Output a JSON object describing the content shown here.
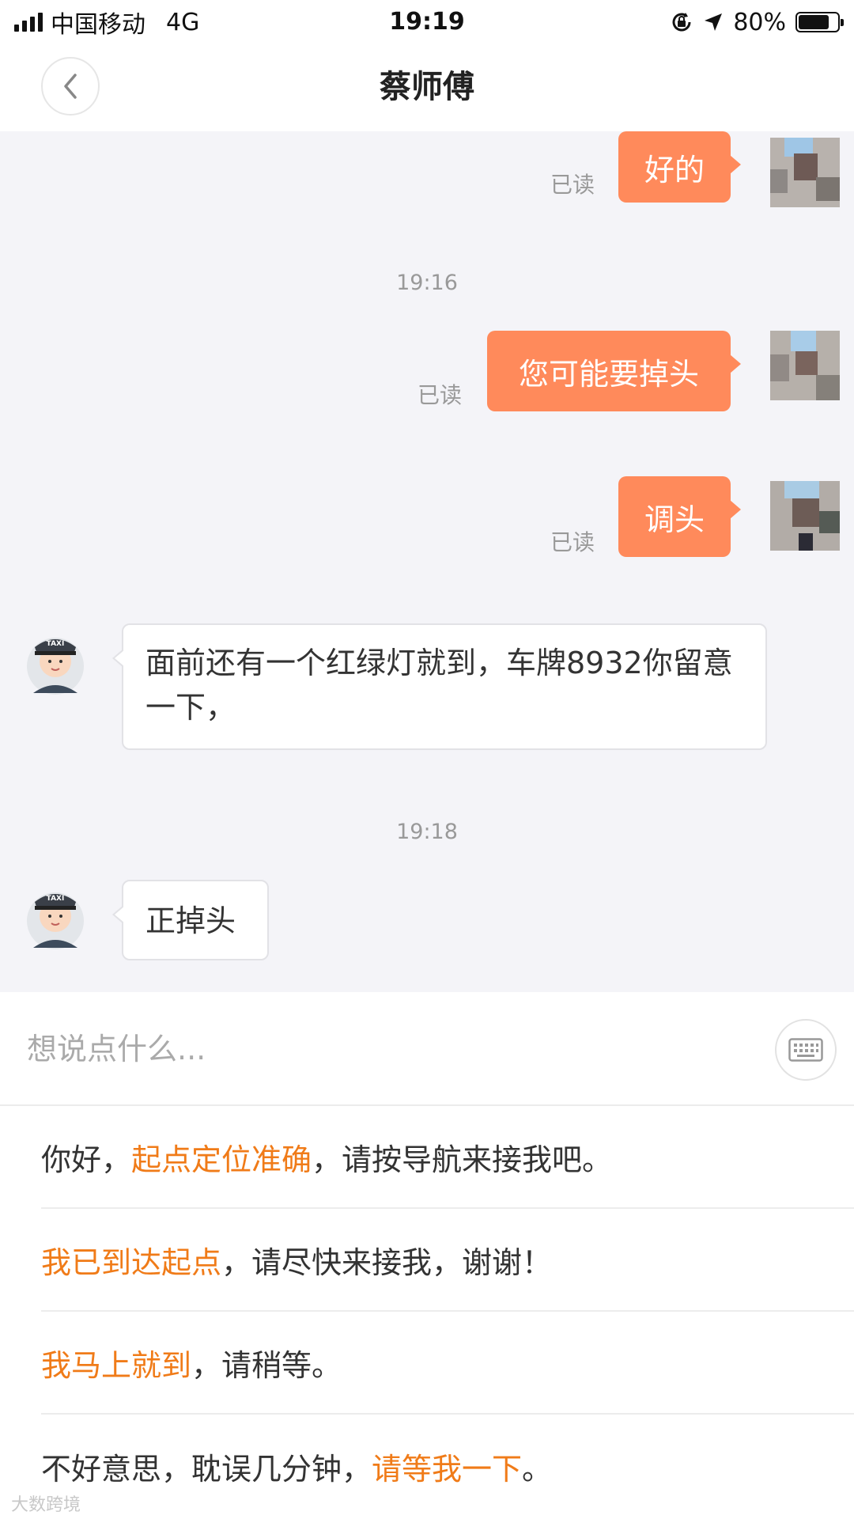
{
  "status_bar": {
    "carrier": "中国移动",
    "network": "4G",
    "time": "19:19",
    "battery": "80%",
    "battery_level": 0.8,
    "icons": [
      "signal-icon",
      "rotation-lock-icon",
      "location-arrow-icon",
      "battery-icon"
    ]
  },
  "header": {
    "title": "蔡师傅",
    "back_icon": "chevron-left-icon"
  },
  "chat": {
    "accent_color": "#ff8a5b",
    "messages": [
      {
        "from": "me",
        "text": "好的",
        "status": "已读"
      },
      {
        "timestamp": "19:16"
      },
      {
        "from": "me",
        "text": "您可能要掉头",
        "status": "已读"
      },
      {
        "from": "me",
        "text": "调头",
        "status": "已读"
      },
      {
        "from": "driver",
        "text": "面前还有一个红绿灯就到，车牌8932你留意一下，",
        "avatar_badge": "TAXI"
      },
      {
        "timestamp": "19:18"
      },
      {
        "from": "driver",
        "text": "正掉头",
        "avatar_badge": "TAXI"
      }
    ]
  },
  "input": {
    "placeholder": "想说点什么...",
    "keyboard_icon": "keyboard-icon"
  },
  "quick_replies": [
    {
      "parts": [
        "你好，",
        "起点定位准确",
        "，请按导航来接我吧。"
      ],
      "highlight_index": 1
    },
    {
      "parts": [
        "我已到达起点",
        "，请尽快来接我，谢谢！"
      ],
      "highlight_index": 0
    },
    {
      "parts": [
        "我马上就到",
        "，请稍等。"
      ],
      "highlight_index": 0
    },
    {
      "parts": [
        "不好意思，耽误几分钟，",
        "请等我一下",
        "。"
      ],
      "highlight_index": 1
    }
  ],
  "highlight_color": "#f07b18",
  "watermark": "大数跨境"
}
